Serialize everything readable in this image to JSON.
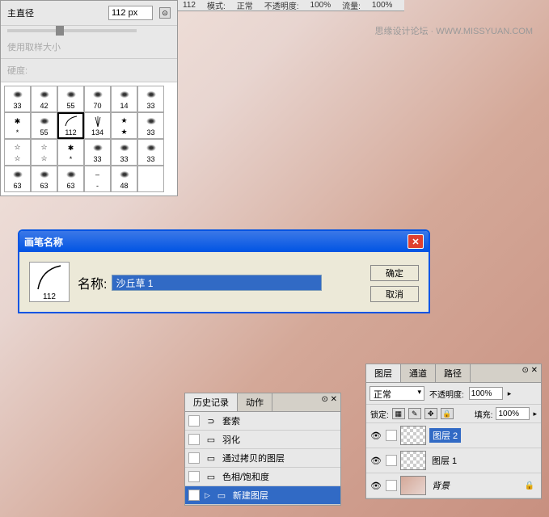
{
  "watermark": "思缘设计论坛 · WWW.MISSYUAN.COM",
  "top_controls": {
    "brush_num": "112",
    "mode_label": "模式:",
    "mode_value": "正常",
    "opacity_label": "不透明度:",
    "opacity_value": "100%",
    "flow_label": "流量:",
    "flow_value": "100%"
  },
  "brush_panel": {
    "diameter_label": "主直径",
    "diameter_value": "112 px",
    "sample_size_label": "使用取样大小",
    "hardness_label": "硬度:",
    "grid": [
      {
        "n": "33",
        "t": "dots"
      },
      {
        "n": "42",
        "t": "dots"
      },
      {
        "n": "55",
        "t": "dots"
      },
      {
        "n": "70",
        "t": "dots"
      },
      {
        "n": "14",
        "t": "strokes"
      },
      {
        "n": "33",
        "t": "strokes2"
      },
      {
        "n": "*",
        "t": "star"
      },
      {
        "n": "55",
        "t": "dots2"
      },
      {
        "n": "112",
        "t": "curve",
        "sel": true
      },
      {
        "n": "134",
        "t": "grass"
      },
      {
        "n": "★",
        "t": "bigstar"
      },
      {
        "n": "33",
        "t": "strokes"
      },
      {
        "n": "☆",
        "t": "outline"
      },
      {
        "n": "☆",
        "t": "outline2"
      },
      {
        "n": "*",
        "t": "burst"
      },
      {
        "n": "33",
        "t": "strokes"
      },
      {
        "n": "33",
        "t": "strokes"
      },
      {
        "n": "33",
        "t": "strokes"
      },
      {
        "n": "63",
        "t": "strokes"
      },
      {
        "n": "63",
        "t": "strokes"
      },
      {
        "n": "63",
        "t": "strokes"
      },
      {
        "n": "-",
        "t": "dash"
      },
      {
        "n": "48",
        "t": "strokes"
      },
      {
        "n": "",
        "t": "blank"
      }
    ]
  },
  "dialog": {
    "title": "画笔名称",
    "preview_size": "112",
    "name_label": "名称:",
    "name_value": "沙丘草 1",
    "ok": "确定",
    "cancel": "取消"
  },
  "history": {
    "tab1": "历史记录",
    "tab2": "动作",
    "items": [
      {
        "label": "套索",
        "icon": "lasso"
      },
      {
        "label": "羽化",
        "icon": "doc"
      },
      {
        "label": "通过拷贝的图层",
        "icon": "doc"
      },
      {
        "label": "色相/饱和度",
        "icon": "doc"
      },
      {
        "label": "新建图层",
        "icon": "doc",
        "sel": true
      }
    ]
  },
  "layers": {
    "tab1": "图层",
    "tab2": "通道",
    "tab3": "路径",
    "blend_mode": "正常",
    "opacity_label": "不透明度:",
    "opacity_value": "100%",
    "lock_label": "锁定:",
    "fill_label": "填充:",
    "fill_value": "100%",
    "rows": [
      {
        "name": "图层 2",
        "sel": true,
        "locked": false
      },
      {
        "name": "图层 1",
        "sel": false,
        "locked": false
      },
      {
        "name": "背景",
        "sel": false,
        "locked": true,
        "italic": true
      }
    ]
  }
}
